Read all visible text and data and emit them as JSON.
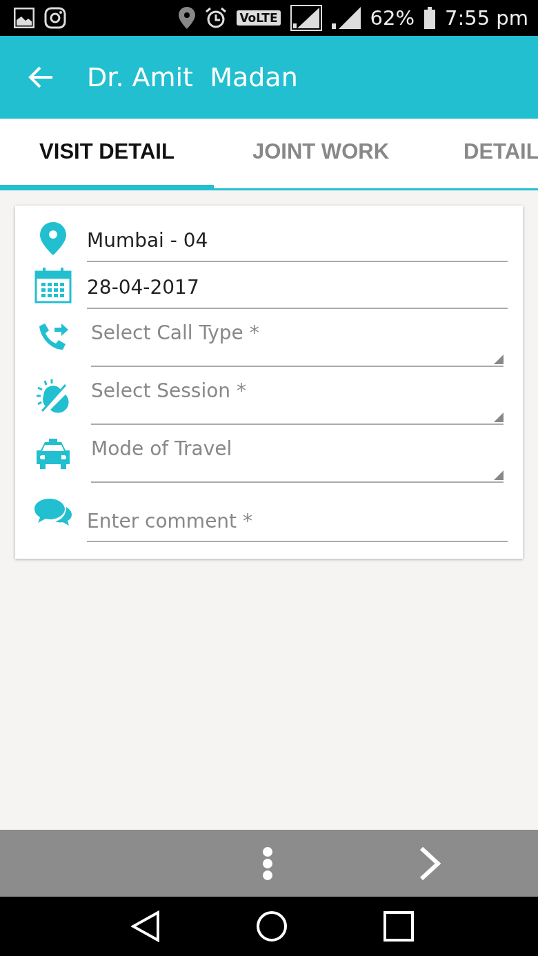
{
  "status_bar": {
    "volte": "VoLTE",
    "battery": "62%",
    "time": "7:55 pm"
  },
  "app_bar": {
    "title": "Dr. Amit  Madan"
  },
  "tabs": [
    {
      "label": "VISIT DETAIL",
      "selected": true
    },
    {
      "label": "JOINT WORK",
      "selected": false
    },
    {
      "label": "DETAIL",
      "selected": false
    }
  ],
  "form": {
    "fields": [
      {
        "kind": "text",
        "value": "Mumbai - 04"
      },
      {
        "kind": "text",
        "value": "28-04-2017"
      },
      {
        "kind": "dropdown",
        "placeholder": "Select Call Type *"
      },
      {
        "kind": "dropdown",
        "placeholder": "Select Session *"
      },
      {
        "kind": "dropdown",
        "placeholder": "Mode of Travel"
      },
      {
        "kind": "input",
        "placeholder": "Enter comment *"
      }
    ]
  }
}
